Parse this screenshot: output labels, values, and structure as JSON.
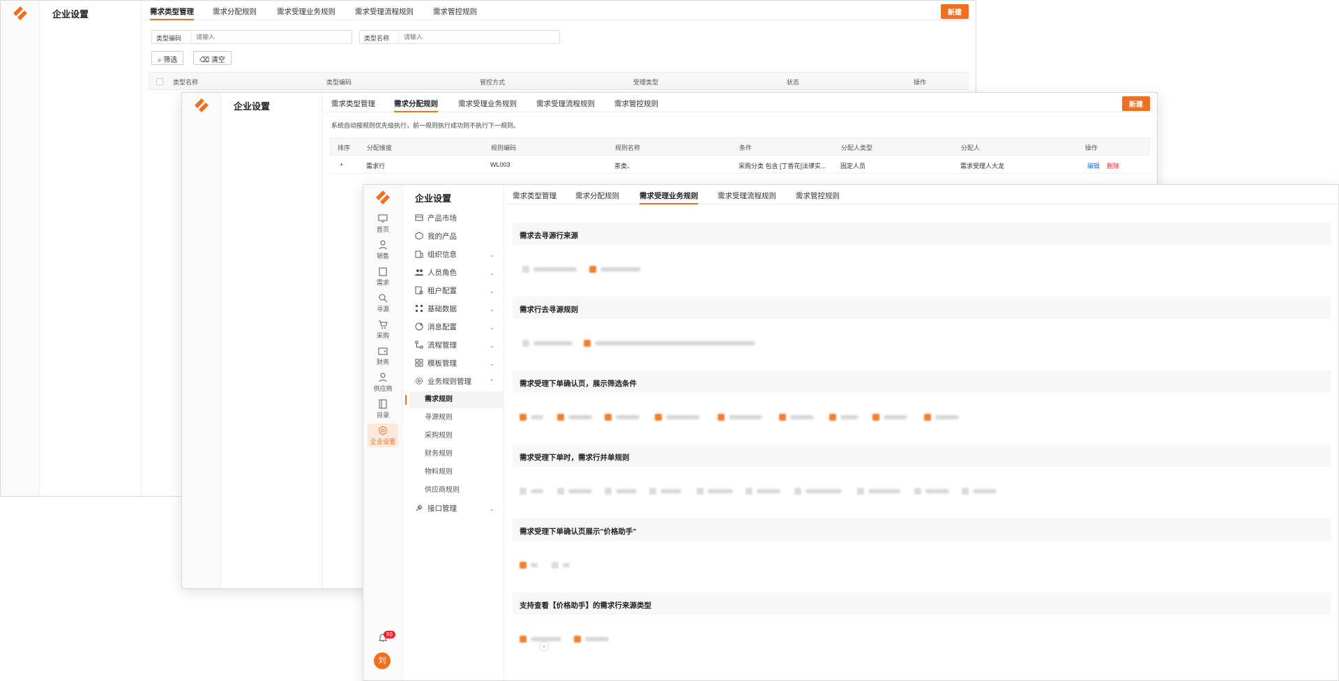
{
  "menu": {
    "title": "企业设置",
    "items": [
      {
        "label": "产品市场",
        "icon": "market-icon"
      },
      {
        "label": "我的产品",
        "icon": "cube-icon"
      },
      {
        "label": "组织信息",
        "icon": "org-icon"
      },
      {
        "label": "人员角色",
        "icon": "people-icon"
      },
      {
        "label": "租户配置",
        "icon": "tenant-icon"
      },
      {
        "label": "基础数据",
        "icon": "data-icon"
      },
      {
        "label": "消息配置",
        "icon": "message-icon"
      },
      {
        "label": "流程管理",
        "icon": "flow-icon"
      },
      {
        "label": "模板管理",
        "icon": "template-icon"
      }
    ],
    "w1_group_label": "业务规则管理",
    "group_label": "业务规则管理",
    "sub_items": [
      "需求规则",
      "寻源规则",
      "采购规则",
      "财务规则",
      "物料规则",
      "供应商规则"
    ],
    "last_item": "接口管理"
  },
  "rail": {
    "items": [
      "首页",
      "销售",
      "需求",
      "寻源",
      "采购",
      "财务",
      "供应商",
      "目录",
      "企业设置"
    ],
    "badge": "99",
    "avatar": "刘"
  },
  "tabs": [
    "需求类型管理",
    "需求分配规则",
    "需求受理业务规则",
    "需求受理流程规则",
    "需求管控规则"
  ],
  "new_button": "新建",
  "w1": {
    "filters": [
      {
        "label": "类型编码",
        "placeholder": "请输入"
      },
      {
        "label": "类型名称",
        "placeholder": "请输入"
      }
    ],
    "filter_button": "筛选",
    "clear_button": "清空",
    "columns": [
      "类型名称",
      "类型编码",
      "管控方式",
      "受理类型",
      "状态",
      "操作"
    ]
  },
  "w2": {
    "notice": "系统自动按规则优先级执行，前一规则执行成功则不执行下一规则。",
    "columns": [
      "排序",
      "分配维度",
      "规则编码",
      "规则名称",
      "条件",
      "分配人类型",
      "分配人",
      "操作"
    ],
    "row": {
      "sort": "+",
      "dimension": "需求行",
      "code": "WL003",
      "name": "茶类、",
      "condition": "采购分类 包含 [丁香花]法律实...",
      "assignee_type": "固定人员",
      "assignee": "需求受理人大龙",
      "edit": "编辑",
      "delete": "删除"
    }
  },
  "w3": {
    "sections": [
      "需求去寻源行来源",
      "需求行去寻源规则",
      "需求受理下单确认页，展示筛选条件",
      "需求受理下单时，需求行并单规则",
      "需求受理下单确认页展示\"价格助手\"",
      "支持查看【价格助手】的需求行来源类型"
    ]
  },
  "colors": {
    "accent": "#f07020",
    "link": "#1677ff",
    "danger": "#f5222d"
  }
}
